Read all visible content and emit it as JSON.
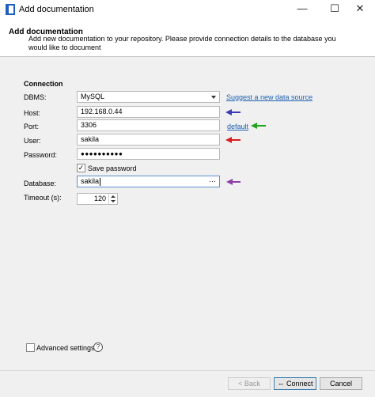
{
  "window": {
    "title": "Add documentation",
    "minimize": "—",
    "maximize": "☐",
    "close": "✕"
  },
  "header": {
    "title": "Add documentation",
    "description": "Add new documentation to your repository. Please provide connection details to the database you would like to document"
  },
  "connection": {
    "section_title": "Connection",
    "dbms_label": "DBMS:",
    "dbms_value": "MySQL",
    "suggest_link": "Suggest a new data source",
    "host_label": "Host:",
    "host_value": "192.168.0.44",
    "port_label": "Port:",
    "port_value": "3306",
    "port_default_link": "default",
    "user_label": "User:",
    "user_value": "sakila",
    "password_label": "Password:",
    "password_value": "●●●●●●●●●●",
    "save_password_label": "Save password",
    "save_password_checked": "✓",
    "database_label": "Database:",
    "database_value": "sakila",
    "database_browse": "···",
    "timeout_label": "Timeout (s):",
    "timeout_value": "120"
  },
  "annotations": {
    "host_arrow_color": "#3b3bb3",
    "port_arrow_color": "#1ea51e",
    "user_arrow_color": "#d81e1e",
    "database_arrow_color": "#8e3ea8"
  },
  "footer": {
    "advanced_settings_label": "Advanced settings",
    "help": "?",
    "back_label": "<  Back",
    "connect_label": "⇔  Connect",
    "cancel_label": "Cancel"
  }
}
